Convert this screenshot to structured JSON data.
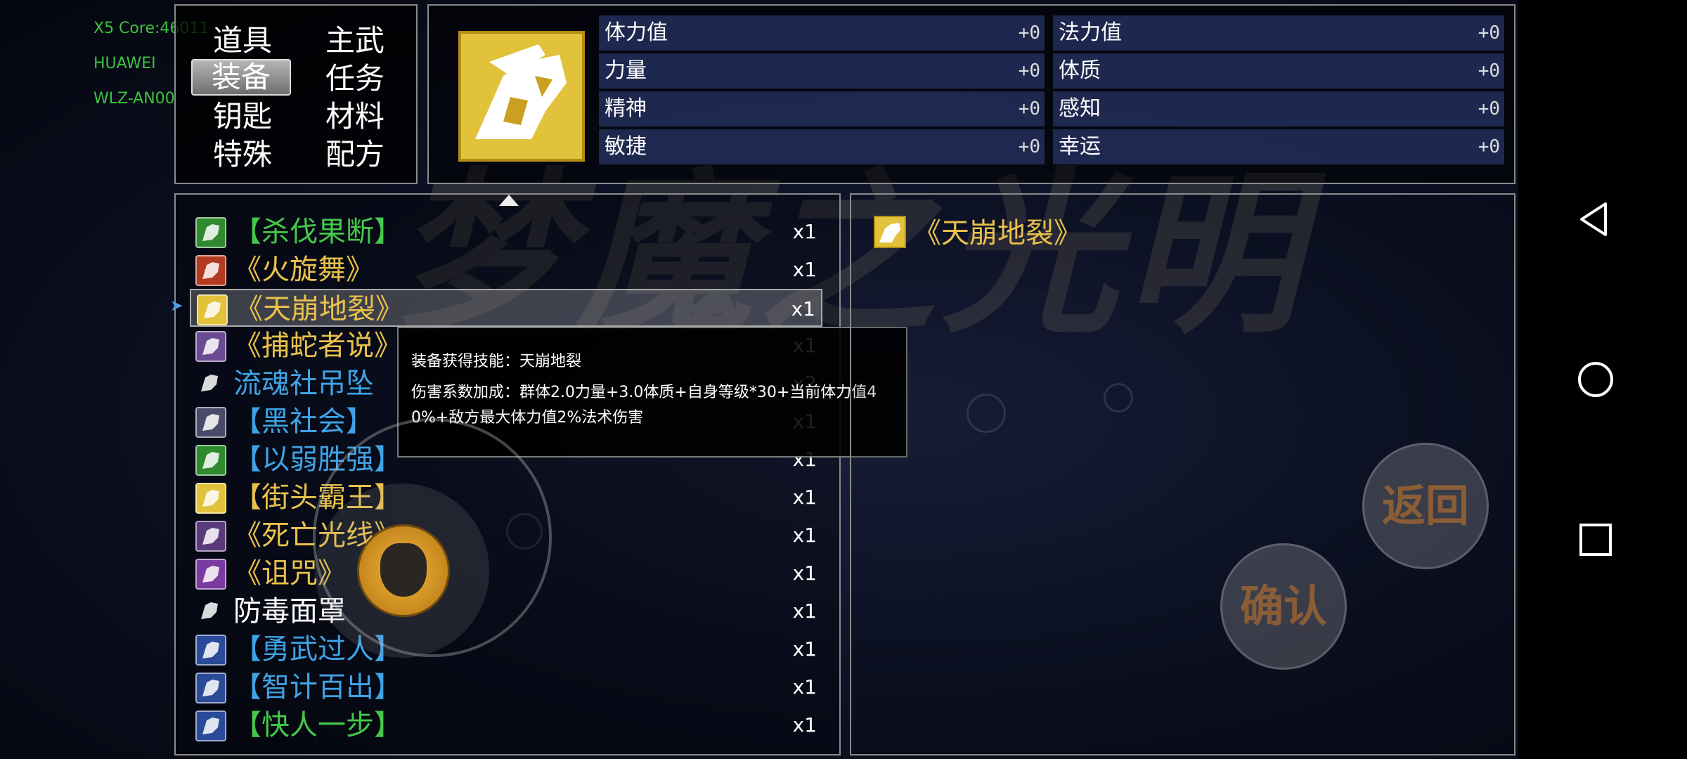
{
  "debug": {
    "line1": "X5 Core:46011",
    "line2": "HUAWEI",
    "line3": "WLZ-AN00"
  },
  "watermark": "梦魔之光明",
  "categories": [
    {
      "label": "道具",
      "selected": false
    },
    {
      "label": "主武",
      "selected": false
    },
    {
      "label": "装备",
      "selected": true
    },
    {
      "label": "任务",
      "selected": false
    },
    {
      "label": "钥匙",
      "selected": false
    },
    {
      "label": "材料",
      "selected": false
    },
    {
      "label": "特殊",
      "selected": false
    },
    {
      "label": "配方",
      "selected": false
    }
  ],
  "stats": [
    {
      "label": "体力值",
      "value": "+0"
    },
    {
      "label": "法力值",
      "value": "+0"
    },
    {
      "label": "力量",
      "value": "+0"
    },
    {
      "label": "体质",
      "value": "+0"
    },
    {
      "label": "精神",
      "value": "+0"
    },
    {
      "label": "感知",
      "value": "+0"
    },
    {
      "label": "敏捷",
      "value": "+0"
    },
    {
      "label": "幸运",
      "value": "+0"
    }
  ],
  "items": [
    {
      "name": "【杀伐果断】",
      "count": "x1",
      "color": "#45c84a",
      "icon": "wings-icon",
      "icon_bg": "#2f8a2f"
    },
    {
      "name": "《火旋舞》",
      "count": "x1",
      "color": "#e9c14b",
      "icon": "fire-icon",
      "icon_bg": "#b43a22"
    },
    {
      "name": "《天崩地裂》",
      "count": "x1",
      "color": "#e9c14b",
      "icon": "earthquake-icon",
      "icon_bg": "#e2c23a",
      "selected": true
    },
    {
      "name": "《捕蛇者说》",
      "count": "x1",
      "color": "#e9c14b",
      "icon": "snake-icon",
      "icon_bg": "#6a4a90"
    },
    {
      "name": "流魂社吊坠",
      "count": "x2",
      "color": "#3fa3e6",
      "icon": "pendant-icon",
      "icon_bg": "transparent"
    },
    {
      "name": "【黑社会】",
      "count": "x1",
      "color": "#3fa3e6",
      "icon": "dagger-icon",
      "icon_bg": "#4a4a6a"
    },
    {
      "name": "【以弱胜强】",
      "count": "x1",
      "color": "#3fa3e6",
      "icon": "shield-icon",
      "icon_bg": "#2f8a2f"
    },
    {
      "name": "【街头霸王】",
      "count": "x1",
      "color": "#e9c14b",
      "icon": "fist-icon",
      "icon_bg": "#e2c23a"
    },
    {
      "name": "《死亡光线》",
      "count": "x1",
      "color": "#e9c14b",
      "icon": "crescent-icon",
      "icon_bg": "#5a3a7a"
    },
    {
      "name": "《诅咒》",
      "count": "x1",
      "color": "#e9c14b",
      "icon": "skull-icon",
      "icon_bg": "#7a3aa0"
    },
    {
      "name": "防毒面罩",
      "count": "x1",
      "color": "#ffffff",
      "icon": "gas-mask-icon",
      "icon_bg": "transparent"
    },
    {
      "name": "【勇武过人】",
      "count": "x1",
      "color": "#3fa3e6",
      "icon": "bow-icon",
      "icon_bg": "#2a4a9a"
    },
    {
      "name": "【智计百出】",
      "count": "x1",
      "color": "#3fa3e6",
      "icon": "biohazard-icon",
      "icon_bg": "#2a4a9a"
    },
    {
      "name": "【快人一步】",
      "count": "x1",
      "color": "#45c84a",
      "icon": "sun-icon",
      "icon_bg": "#2a4a9a"
    }
  ],
  "tooltip": {
    "line1": "装备获得技能：天崩地裂",
    "line2": "伤害系数加成：群体2.0力量+3.0体质+自身等级*30+当前体力值4\n0%+敌方最大体力值2%法术伤害"
  },
  "detail": {
    "name": "《天崩地裂》",
    "color": "#e9c14b"
  },
  "buttons": {
    "back": "返回",
    "confirm": "确认"
  }
}
